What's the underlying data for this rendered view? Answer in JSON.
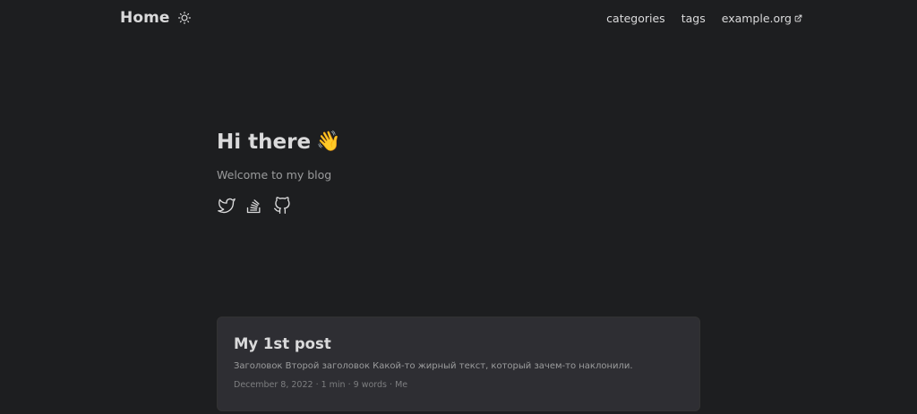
{
  "header": {
    "logo": "Home",
    "theme_toggle_icon": "sun-icon",
    "nav": [
      {
        "label": "categories"
      },
      {
        "label": "tags"
      },
      {
        "label": "example.org",
        "icon": "external-link-icon"
      }
    ]
  },
  "hero": {
    "title": "Hi there",
    "emoji": "👋",
    "subtitle": "Welcome to my blog",
    "social": [
      {
        "icon": "twitter-icon"
      },
      {
        "icon": "stackoverflow-icon"
      },
      {
        "icon": "github-icon"
      }
    ]
  },
  "posts": [
    {
      "title": "My 1st post",
      "summary": "Заголовок Второй заголовок Какой-то жирный текст, который зачем-то наклонили.",
      "meta": "December 8, 2022 · 1 min · 9 words · Me"
    }
  ],
  "colors": {
    "background": "#1d1e20",
    "card": "#2e2e33",
    "primary_text": "#dadadb",
    "secondary_text": "#9b9c9d"
  }
}
